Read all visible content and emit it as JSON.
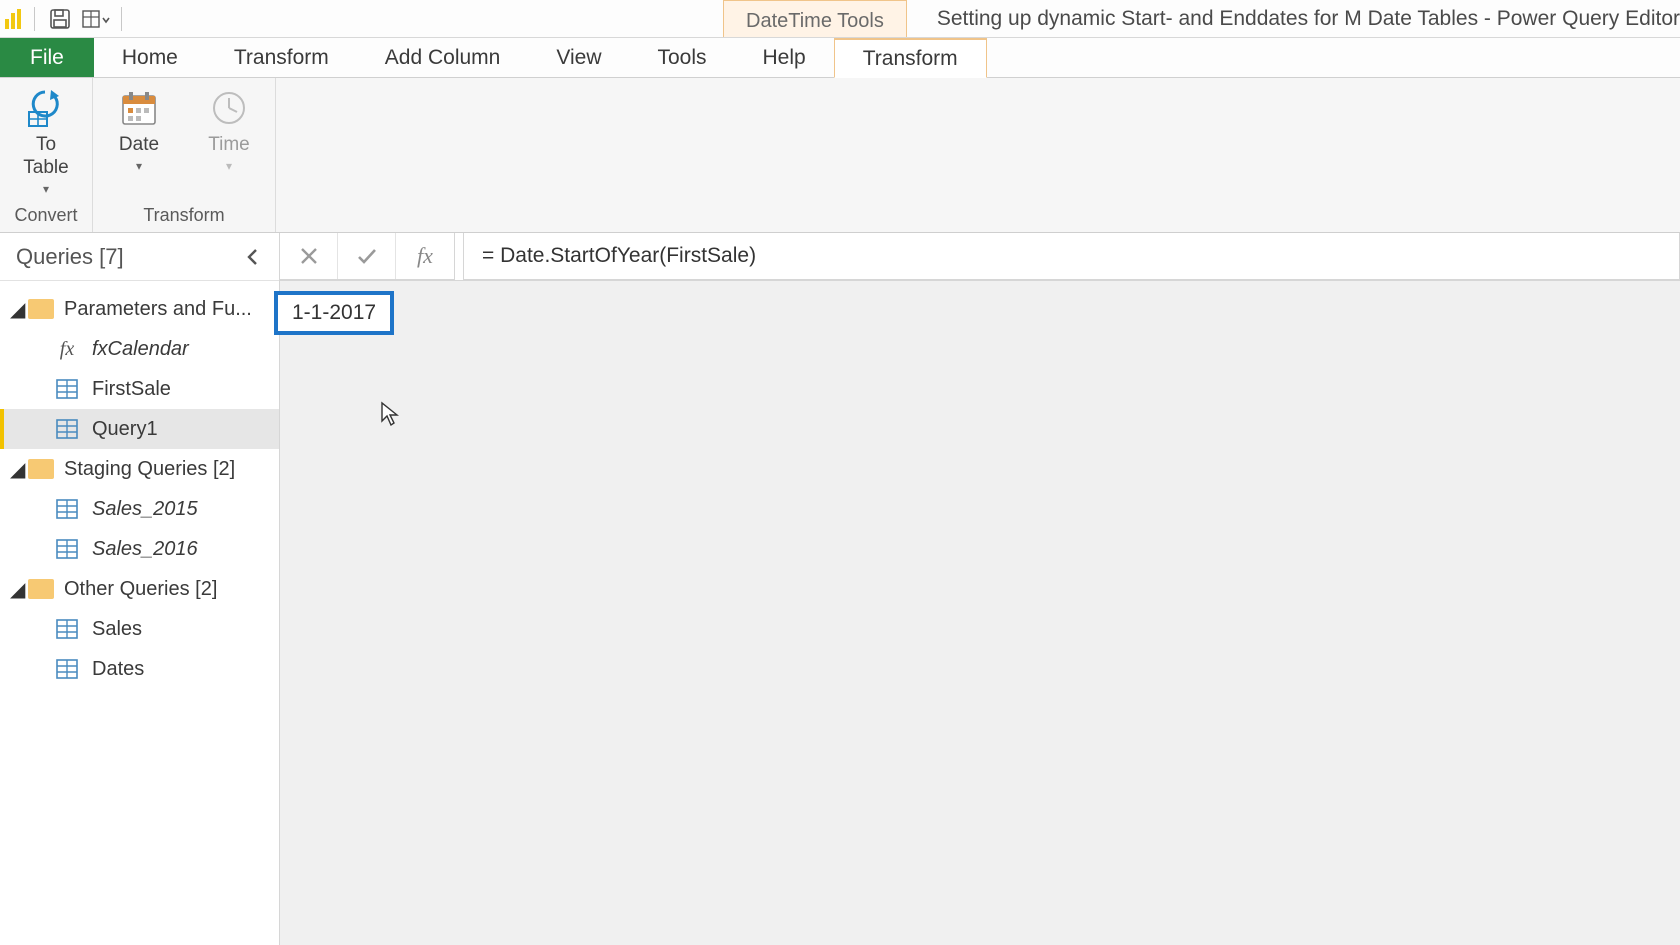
{
  "titlebar": {
    "context_tab": "DateTime Tools",
    "title": "Setting up dynamic Start- and Enddates for M Date Tables - Power Query Editor"
  },
  "ribbon_tabs": {
    "file": "File",
    "home": "Home",
    "transform": "Transform",
    "add_column": "Add Column",
    "view": "View",
    "tools": "Tools",
    "help": "Help",
    "context_transform": "Transform"
  },
  "ribbon": {
    "to_table": "To\nTable",
    "date": "Date",
    "time": "Time",
    "group_convert": "Convert",
    "group_transform": "Transform"
  },
  "queries": {
    "header": "Queries [7]",
    "groups": [
      {
        "label": "Parameters and Fu...",
        "items": [
          {
            "label": "fxCalendar",
            "kind": "fx",
            "italic": true
          },
          {
            "label": "FirstSale",
            "kind": "table"
          },
          {
            "label": "Query1",
            "kind": "table",
            "selected": true
          }
        ]
      },
      {
        "label": "Staging Queries [2]",
        "items": [
          {
            "label": "Sales_2015",
            "kind": "table",
            "italic": true
          },
          {
            "label": "Sales_2016",
            "kind": "table",
            "italic": true
          }
        ]
      },
      {
        "label": "Other Queries [2]",
        "items": [
          {
            "label": "Sales",
            "kind": "table"
          },
          {
            "label": "Dates",
            "kind": "table"
          }
        ]
      }
    ]
  },
  "formula_bar": {
    "formula": "= Date.StartOfYear(FirstSale)"
  },
  "result": {
    "value": "1-1-2017"
  }
}
